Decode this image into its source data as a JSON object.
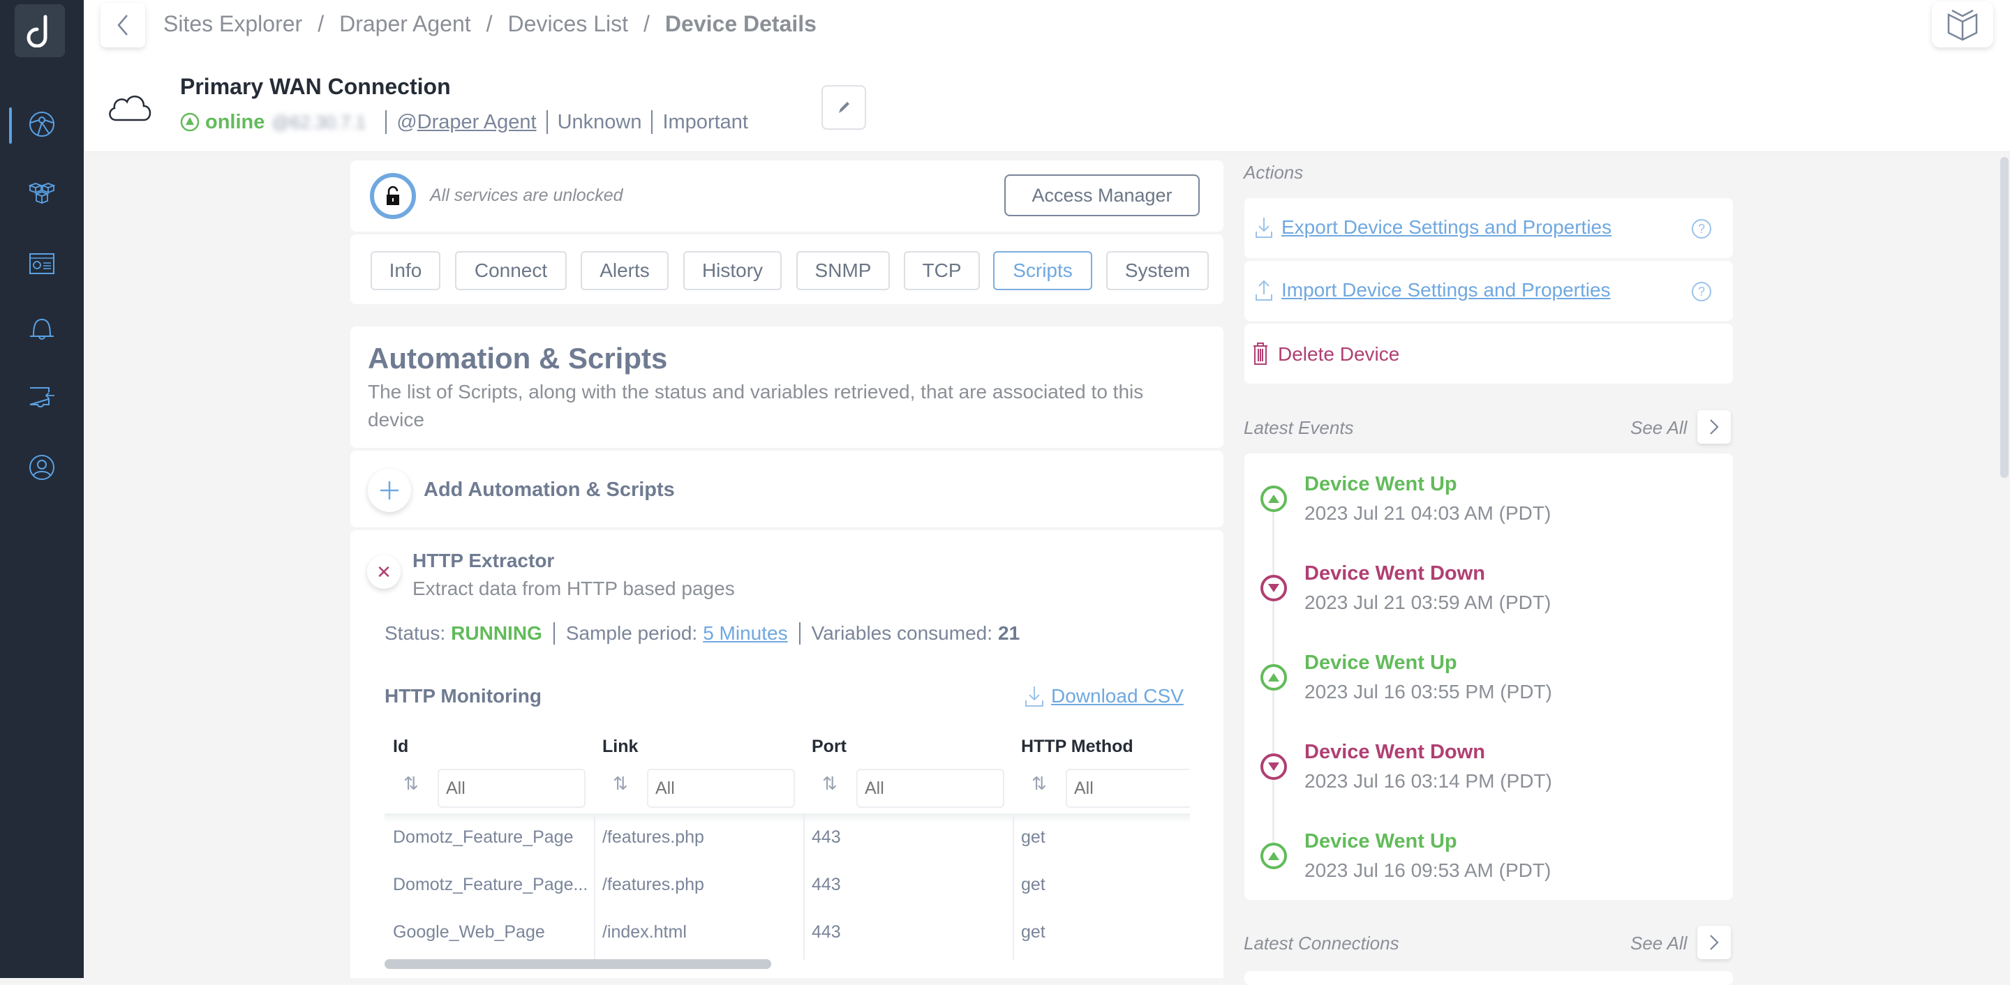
{
  "sidebar": {
    "logo_icon": "domotz-logo-icon",
    "items": [
      {
        "name": "sites-explorer",
        "icon": "globe-network-icon",
        "active": true
      },
      {
        "name": "inventory",
        "icon": "cubes-icon",
        "active": false
      },
      {
        "name": "dashboard",
        "icon": "dashboard-card-icon",
        "active": false
      },
      {
        "name": "alerts",
        "icon": "bell-icon",
        "active": false
      },
      {
        "name": "integrations",
        "icon": "puzzle-arrow-icon",
        "active": false
      },
      {
        "name": "account",
        "icon": "user-circle-icon",
        "active": false
      }
    ]
  },
  "breadcrumb": {
    "items": [
      "Sites Explorer",
      "Draper Agent",
      "Devices List"
    ],
    "current": "Device Details",
    "separator": "/"
  },
  "device": {
    "name": "Primary WAN Connection",
    "status": "online",
    "ip_blurred": "@62.30.7.1",
    "agent": "Draper Agent",
    "agent_prefix": "@",
    "type": "Unknown",
    "importance": "Important"
  },
  "lock": {
    "text": "All services are unlocked",
    "access_manager_label": "Access Manager"
  },
  "tabs": [
    {
      "label": "Info",
      "active": false
    },
    {
      "label": "Connect",
      "active": false
    },
    {
      "label": "Alerts",
      "active": false
    },
    {
      "label": "History",
      "active": false
    },
    {
      "label": "SNMP",
      "active": false
    },
    {
      "label": "TCP",
      "active": false
    },
    {
      "label": "Scripts",
      "active": true
    },
    {
      "label": "System",
      "active": false
    }
  ],
  "scripts": {
    "title": "Automation & Scripts",
    "description": "The list of Scripts, along with the status and variables retrieved, that are associated to this device",
    "add_label": "Add Automation & Scripts",
    "script": {
      "name": "HTTP Extractor",
      "description": "Extract data from HTTP based pages",
      "status_label": "Status:",
      "status": "RUNNING",
      "sample_label": "Sample period:",
      "sample_period": "5 Minutes",
      "vars_label": "Variables consumed:",
      "vars_consumed": "21"
    },
    "monitoring": {
      "title": "HTTP Monitoring",
      "download_label": "Download CSV",
      "columns": [
        "Id",
        "Link",
        "Port",
        "HTTP Method"
      ],
      "filter_placeholder": "All",
      "rows": [
        [
          "Domotz_Feature_Page",
          "/features.php",
          "443",
          "get"
        ],
        [
          "Domotz_Feature_Page...",
          "/features.php",
          "443",
          "get"
        ],
        [
          "Google_Web_Page",
          "/index.html",
          "443",
          "get"
        ]
      ]
    }
  },
  "actions": {
    "title": "Actions",
    "export_label": "Export Device Settings and Properties",
    "import_label": "Import Device Settings and Properties",
    "delete_label": "Delete Device"
  },
  "events": {
    "title": "Latest Events",
    "see_all": "See All",
    "items": [
      {
        "title": "Device Went Up",
        "time": "2023 Jul 21 04:03 AM (PDT)",
        "kind": "up"
      },
      {
        "title": "Device Went Down",
        "time": "2023 Jul 21 03:59 AM (PDT)",
        "kind": "down"
      },
      {
        "title": "Device Went Up",
        "time": "2023 Jul 16 03:55 PM (PDT)",
        "kind": "up"
      },
      {
        "title": "Device Went Down",
        "time": "2023 Jul 16 03:14 PM (PDT)",
        "kind": "down"
      },
      {
        "title": "Device Went Up",
        "time": "2023 Jul 16 09:53 AM (PDT)",
        "kind": "up"
      }
    ]
  },
  "connections": {
    "title": "Latest Connections",
    "see_all": "See All"
  },
  "colors": {
    "accent": "#6fa8e0",
    "up": "#62bb5a",
    "down": "#b03f72",
    "sidebar": "#232b38"
  }
}
